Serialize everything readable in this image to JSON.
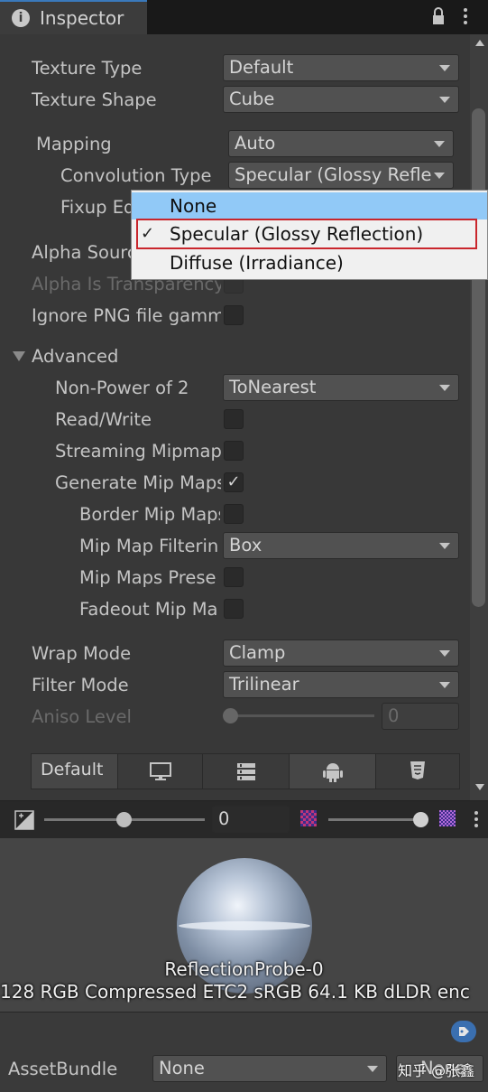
{
  "tab": {
    "title": "Inspector",
    "icon": "info-icon"
  },
  "fields": {
    "texture_type": {
      "label": "Texture Type",
      "value": "Default"
    },
    "texture_shape": {
      "label": "Texture Shape",
      "value": "Cube"
    },
    "mapping": {
      "label": "Mapping",
      "value": "Auto"
    },
    "convolution_type": {
      "label": "Convolution Type",
      "value": "Specular (Glossy Refle"
    },
    "fixup_edge": {
      "label": "Fixup Ed"
    },
    "alpha_source": {
      "label": "Alpha Sourc"
    },
    "alpha_is_transparency": {
      "label": "Alpha Is Transparency"
    },
    "ignore_png": {
      "label": "Ignore PNG file gamm"
    }
  },
  "advanced": {
    "header": "Advanced",
    "non_power_of_2": {
      "label": "Non-Power of 2",
      "value": "ToNearest"
    },
    "read_write": {
      "label": "Read/Write"
    },
    "streaming_mipmap": {
      "label": "Streaming Mipmap"
    },
    "generate_mip_maps": {
      "label": "Generate Mip Maps",
      "checked": true
    },
    "border_mip_maps": {
      "label": "Border Mip Maps"
    },
    "mip_map_filtering": {
      "label": "Mip Map Filterin",
      "value": "Box"
    },
    "mip_maps_preserve": {
      "label": "Mip Maps Prese"
    },
    "fadeout_mip_maps": {
      "label": "Fadeout Mip Ma"
    }
  },
  "wrap_mode": {
    "label": "Wrap Mode",
    "value": "Clamp"
  },
  "filter_mode": {
    "label": "Filter Mode",
    "value": "Trilinear"
  },
  "aniso_level": {
    "label": "Aniso Level",
    "value": "0",
    "level": 0
  },
  "platform_tabs": {
    "default": "Default",
    "icons": [
      "monitor-icon",
      "server-icon",
      "android-icon",
      "html5-icon"
    ]
  },
  "dropdown_popup": {
    "items": [
      {
        "label": "None",
        "selected": false,
        "highlighted": true
      },
      {
        "label": "Specular (Glossy Reflection)",
        "selected": true,
        "highlighted": false
      },
      {
        "label": "Diffuse (Irradiance)",
        "selected": false,
        "highlighted": false
      }
    ]
  },
  "preview": {
    "mip_value": "0",
    "name": "ReflectionProbe-0",
    "info": "128  RGB Compressed ETC2 sRGB   64.1 KB   dLDR enc"
  },
  "asset_bundle": {
    "label": "AssetBundle",
    "value": "None",
    "variant": "None"
  },
  "watermark": "知乎 @张鑫",
  "colors": {
    "accent": "#3a79bb",
    "popup_highlight": "#91c9f7",
    "selection_outline": "#c9262c"
  }
}
